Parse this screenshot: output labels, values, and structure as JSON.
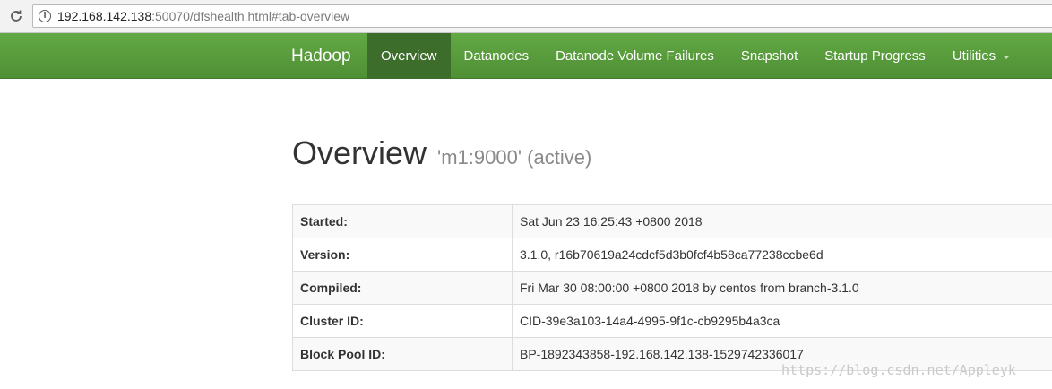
{
  "browser": {
    "url_host": "192.168.142.138",
    "url_rest": ":50070/dfshealth.html#tab-overview"
  },
  "navbar": {
    "brand": "Hadoop",
    "items": [
      {
        "label": "Overview",
        "active": true
      },
      {
        "label": "Datanodes"
      },
      {
        "label": "Datanode Volume Failures"
      },
      {
        "label": "Snapshot"
      },
      {
        "label": "Startup Progress"
      },
      {
        "label": "Utilities",
        "dropdown": true
      }
    ],
    "colors": {
      "bar": "#5a9e3d",
      "active": "#3c6d2a"
    }
  },
  "page": {
    "title": "Overview",
    "subtitle": "'m1:9000' (active)"
  },
  "overview_table": [
    {
      "key": "Started:",
      "value": "Sat Jun 23 16:25:43 +0800 2018"
    },
    {
      "key": "Version:",
      "value": "3.1.0, r16b70619a24cdcf5d3b0fcf4b58ca77238ccbe6d"
    },
    {
      "key": "Compiled:",
      "value": "Fri Mar 30 08:00:00 +0800 2018 by centos from branch-3.1.0"
    },
    {
      "key": "Cluster ID:",
      "value": "CID-39e3a103-14a4-4995-9f1c-cb9295b4a3ca"
    },
    {
      "key": "Block Pool ID:",
      "value": "BP-1892343858-192.168.142.138-1529742336017"
    }
  ],
  "watermark": "https://blog.csdn.net/Appleyk"
}
